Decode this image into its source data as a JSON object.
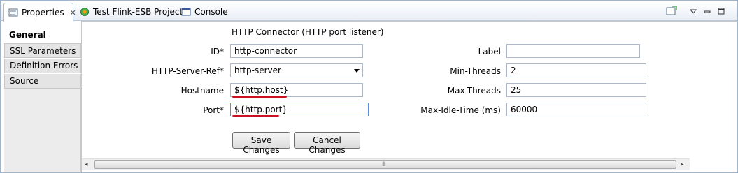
{
  "tabs": [
    {
      "label": "Properties",
      "icon": "properties-icon",
      "active": true,
      "closable": true
    },
    {
      "label": "Test Flink-ESB Project",
      "icon": "project-icon",
      "active": false
    },
    {
      "label": "Console",
      "icon": "console-icon",
      "active": false
    }
  ],
  "view_tools": {
    "pin_icon": "pin-icon",
    "menu_icon": "view-menu-icon",
    "minimize_icon": "minimize-icon",
    "maximize_icon": "maximize-icon"
  },
  "nav": {
    "items": [
      "General",
      "SSL Parameters",
      "Definition Errors",
      "Source"
    ],
    "selected": "General"
  },
  "form": {
    "heading": "HTTP Connector (HTTP port listener)",
    "id_label": "ID*",
    "id_value": "http-connector",
    "server_ref_label": "HTTP-Server-Ref*",
    "server_ref_value": "http-server",
    "hostname_label": "Hostname",
    "hostname_value": "${http.host}",
    "port_label": "Port*",
    "port_value": "${http.port}",
    "label_label": "Label",
    "label_value": "",
    "min_threads_label": "Min-Threads",
    "min_threads_value": "2",
    "max_threads_label": "Max-Threads",
    "max_threads_value": "25",
    "max_idle_label": "Max-Idle-Time (ms)",
    "max_idle_value": "60000"
  },
  "buttons": {
    "save": "Save Changes",
    "cancel": "Cancel Changes"
  },
  "scrollbar": {
    "left_arrow": "◂",
    "right_arrow": "▸",
    "grip": "III"
  },
  "colors": {
    "highlight_underline": "#cc1020",
    "focus_border": "#5a8ed8"
  }
}
